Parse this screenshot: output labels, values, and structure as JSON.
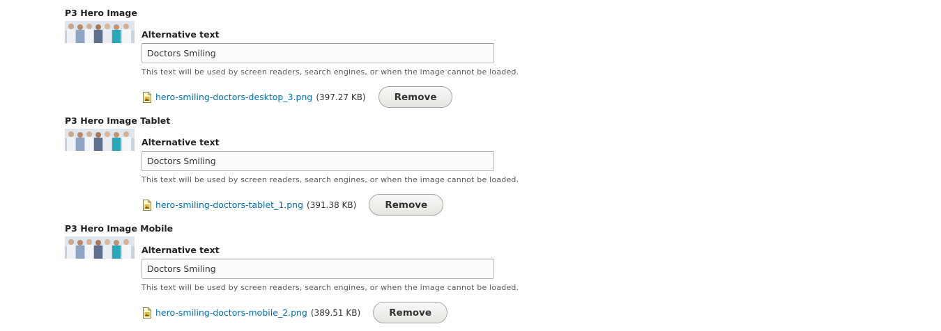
{
  "fields": [
    {
      "label": "P3 Hero Image",
      "alt_label": "Alternative text",
      "alt_value": "Doctors Smiling",
      "description": "This text will be used by screen readers, search engines, or when the image cannot be loaded.",
      "file_name": "hero-smiling-doctors-desktop_3.png",
      "file_size": "(397.27 KB)",
      "remove_label": "Remove"
    },
    {
      "label": "P3 Hero Image Tablet",
      "alt_label": "Alternative text",
      "alt_value": "Doctors Smiling",
      "description": "This text will be used by screen readers, search engines, or when the image cannot be loaded.",
      "file_name": "hero-smiling-doctors-tablet_1.png",
      "file_size": "(391.38 KB)",
      "remove_label": "Remove"
    },
    {
      "label": "P3 Hero Image Mobile",
      "alt_label": "Alternative text",
      "alt_value": "Doctors Smiling",
      "description": "This text will be used by screen readers, search engines, or when the image cannot be loaded.",
      "file_name": "hero-smiling-doctors-mobile_2.png",
      "file_size": "(389.51 KB)",
      "remove_label": "Remove"
    }
  ],
  "icons": {
    "file": "image-file-icon",
    "thumbnail": "doctors-thumbnail-image"
  },
  "colors": {
    "link": "#0071b3",
    "text": "#222222",
    "description": "#595959",
    "input_border": "#b8b8b8",
    "button_border": "#a6a6a6"
  }
}
